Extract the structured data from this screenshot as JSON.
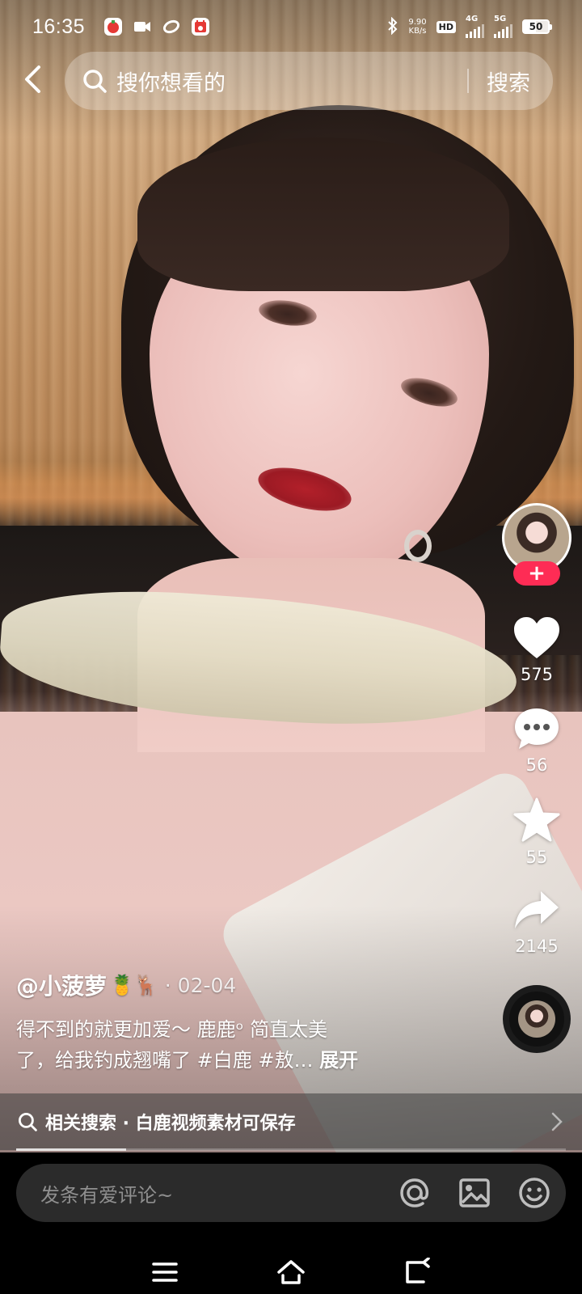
{
  "status_bar": {
    "time": "16:35",
    "app_icons": [
      "tomato-app-icon",
      "video-camera-icon",
      "link-app-icon",
      "calendar-app-icon"
    ],
    "bluetooth": "bluetooth-icon",
    "net_speed_value": "9.90",
    "net_speed_unit": "KB/s",
    "hd_label": "HD",
    "sim1_network": "4G",
    "sim2_network": "5G",
    "battery_level": "50"
  },
  "header": {
    "back_icon": "chevron-left-icon",
    "search_placeholder": "搜你想看的",
    "search_button": "搜索"
  },
  "actions": {
    "follow_label": "+",
    "like_count": "575",
    "comment_count": "56",
    "favorite_count": "55",
    "share_count": "2145"
  },
  "post": {
    "author": "@小菠萝",
    "author_emojis": "🍍🦌",
    "date": "· 02-04",
    "caption_line1": "得不到的就更加爱〜 鹿鹿ᵒ 简直太美",
    "caption_line2": "了，给我钓成翘嘴了 #白鹿 #敖… ",
    "expand_label": "展开"
  },
  "related_search": {
    "label": "相关搜索 · 白鹿视频素材可保存"
  },
  "comment_bar": {
    "placeholder": "发条有爱评论~",
    "icons": [
      "at-mention-icon",
      "image-icon",
      "emoji-icon"
    ]
  },
  "progress": {
    "played_fraction": 0.2
  },
  "colors": {
    "follow_accent": "#fe2c55",
    "comment_box_bg": "#2b2b2b",
    "placeholder_text": "#8f8f8f"
  }
}
